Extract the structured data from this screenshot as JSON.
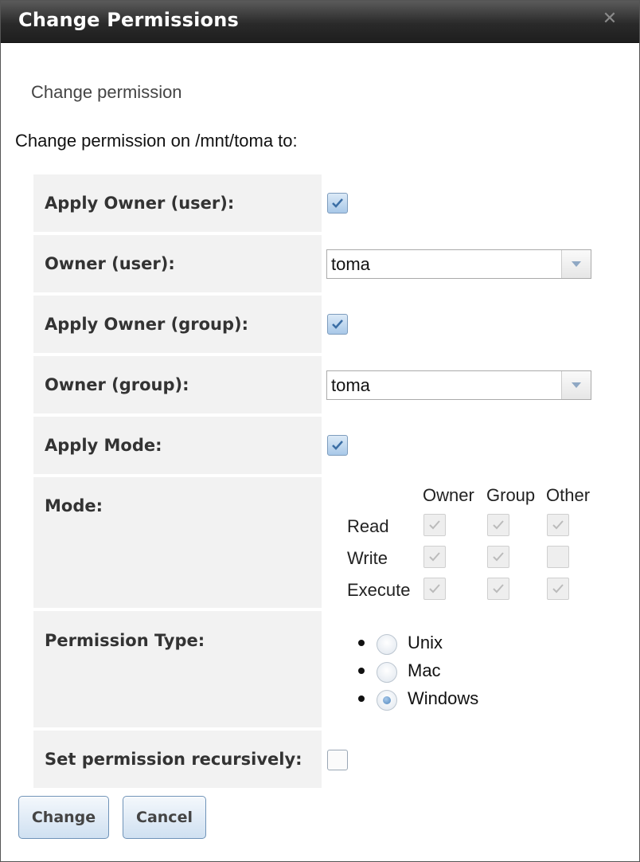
{
  "dialog": {
    "title": "Change Permissions",
    "close_icon": "close-icon",
    "subtitle": "Change permission",
    "intro": "Change permission on /mnt/toma to:"
  },
  "form": {
    "apply_owner_user": {
      "label": "Apply Owner (user):",
      "checked": true
    },
    "owner_user": {
      "label": "Owner (user):",
      "value": "toma"
    },
    "apply_owner_group": {
      "label": "Apply Owner (group):",
      "checked": true
    },
    "owner_group": {
      "label": "Owner (group):",
      "value": "toma"
    },
    "apply_mode": {
      "label": "Apply Mode:",
      "checked": true
    },
    "mode": {
      "label": "Mode:",
      "columns": [
        "Owner",
        "Group",
        "Other"
      ],
      "rows": [
        {
          "name": "Read",
          "owner": true,
          "group": true,
          "other": true
        },
        {
          "name": "Write",
          "owner": true,
          "group": true,
          "other": false
        },
        {
          "name": "Execute",
          "owner": true,
          "group": true,
          "other": true
        }
      ]
    },
    "permission_type": {
      "label": "Permission Type:",
      "options": [
        "Unix",
        "Mac",
        "Windows"
      ],
      "selected": "Windows"
    },
    "recursive": {
      "label": "Set permission recursively:",
      "checked": false
    }
  },
  "buttons": {
    "change": "Change",
    "cancel": "Cancel"
  },
  "colors": {
    "titlebar": "#2a2a2a",
    "label_bg": "#f2f2f2",
    "button_border": "#6f93b8"
  }
}
